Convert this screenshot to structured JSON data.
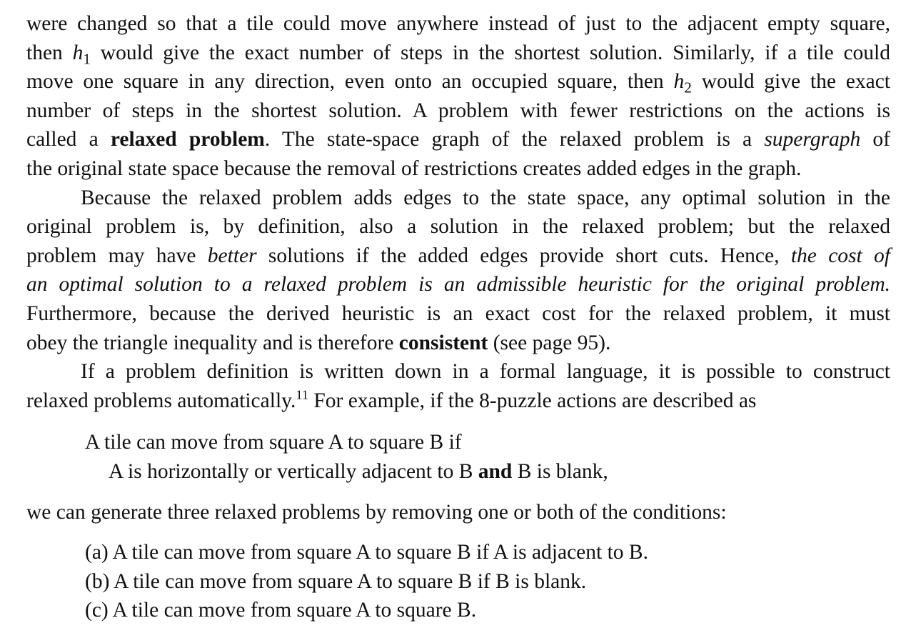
{
  "p1": {
    "l1": "were changed so that a tile could move anywhere instead of just to the adjacent empty square,",
    "l2_a": "then ",
    "l2_h": "h",
    "l2_sub": "1",
    "l2_b": " would give the exact number of steps in the shortest solution. Similarly, if a tile could",
    "l3_a": "move one square in any direction, even onto an occupied square, then ",
    "l3_h": "h",
    "l3_sub": "2",
    "l3_b": " would give the exact",
    "l4": "number of steps in the shortest solution. A problem with fewer restrictions on the actions is",
    "l5_a": "called a ",
    "l5_term": "relaxed problem",
    "l5_b": ". The state-space graph of the relaxed problem is a ",
    "l5_em": "supergraph",
    "l5_c": " of",
    "l6": "the original state space because the removal of restrictions creates added edges in the graph."
  },
  "p2": {
    "l1": "Because the relaxed problem adds edges to the state space, any optimal solution in the",
    "l2": "original problem is, by definition, also a solution in the relaxed problem; but the relaxed",
    "l3_a": "problem may have ",
    "l3_em": "better",
    "l3_b": " solutions if the added edges provide short cuts. Hence, ",
    "l3_em2": "the cost of",
    "l4_em": "an optimal solution to a relaxed problem is an admissible heuristic for the original problem.",
    "l5": "Furthermore, because the derived heuristic is an exact cost for the relaxed problem, it must",
    "l6_a": "obey the triangle inequality and is therefore ",
    "l6_term": "consistent",
    "l6_b": " (see page 95)."
  },
  "p3": {
    "l1": "If a problem definition is written down in a formal language, it is possible to construct",
    "l2_a": "relaxed problems automatically.",
    "l2_fn": "11",
    "l2_b": " For example, if the 8-puzzle actions are described as"
  },
  "rule": {
    "l1": "A tile can move from square A to square B if",
    "l2_a": "A is horizontally or vertically adjacent to B ",
    "l2_and": "and",
    "l2_b": " B is blank,"
  },
  "after_rule": "we can generate three relaxed problems by removing one or both of the conditions:",
  "options": [
    "(a) A tile can move from square A to square B if A is adjacent to B.",
    "(b) A tile can move from square A to square B if B is blank.",
    "(c) A tile can move from square A to square B."
  ]
}
